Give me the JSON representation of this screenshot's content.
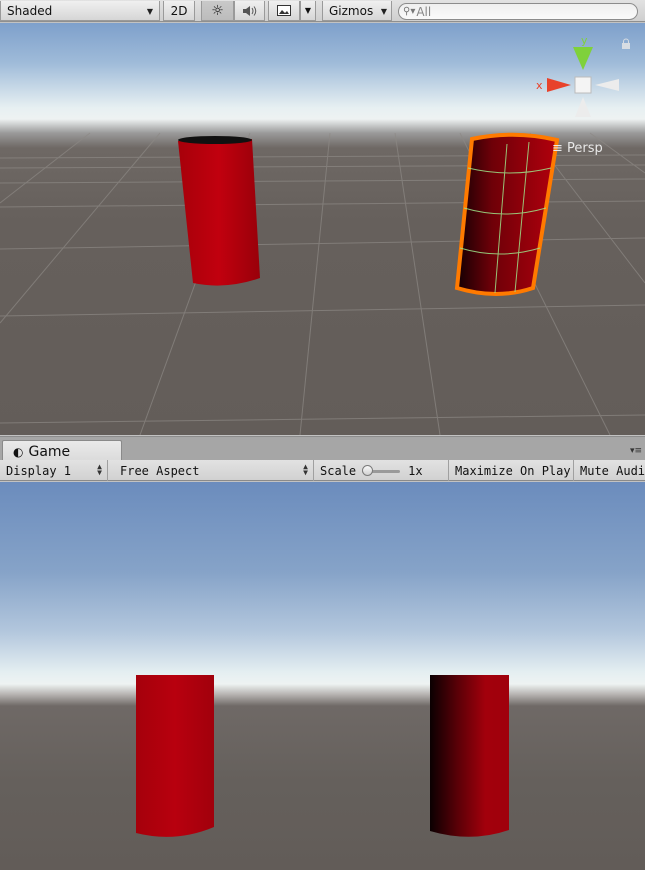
{
  "scene_toolbar": {
    "draw_mode": "Shaded",
    "mode_2d": "2D",
    "gizmos": "Gizmos",
    "search_placeholder": "All"
  },
  "scene": {
    "projection_label": "Persp",
    "axis_y": "y",
    "axis_x": "x"
  },
  "game_tab": {
    "label": "Game"
  },
  "game_toolbar": {
    "display": "Display 1",
    "aspect": "Free Aspect",
    "scale_label": "Scale",
    "scale_value": 1,
    "scale_value_text": "1x",
    "maximize": "Maximize On Play",
    "mute": "Mute Audio"
  },
  "colors": {
    "cylinder_red": "#b0000d",
    "selection_outline": "#ff7a00",
    "wireframe": "#9ee58a"
  }
}
